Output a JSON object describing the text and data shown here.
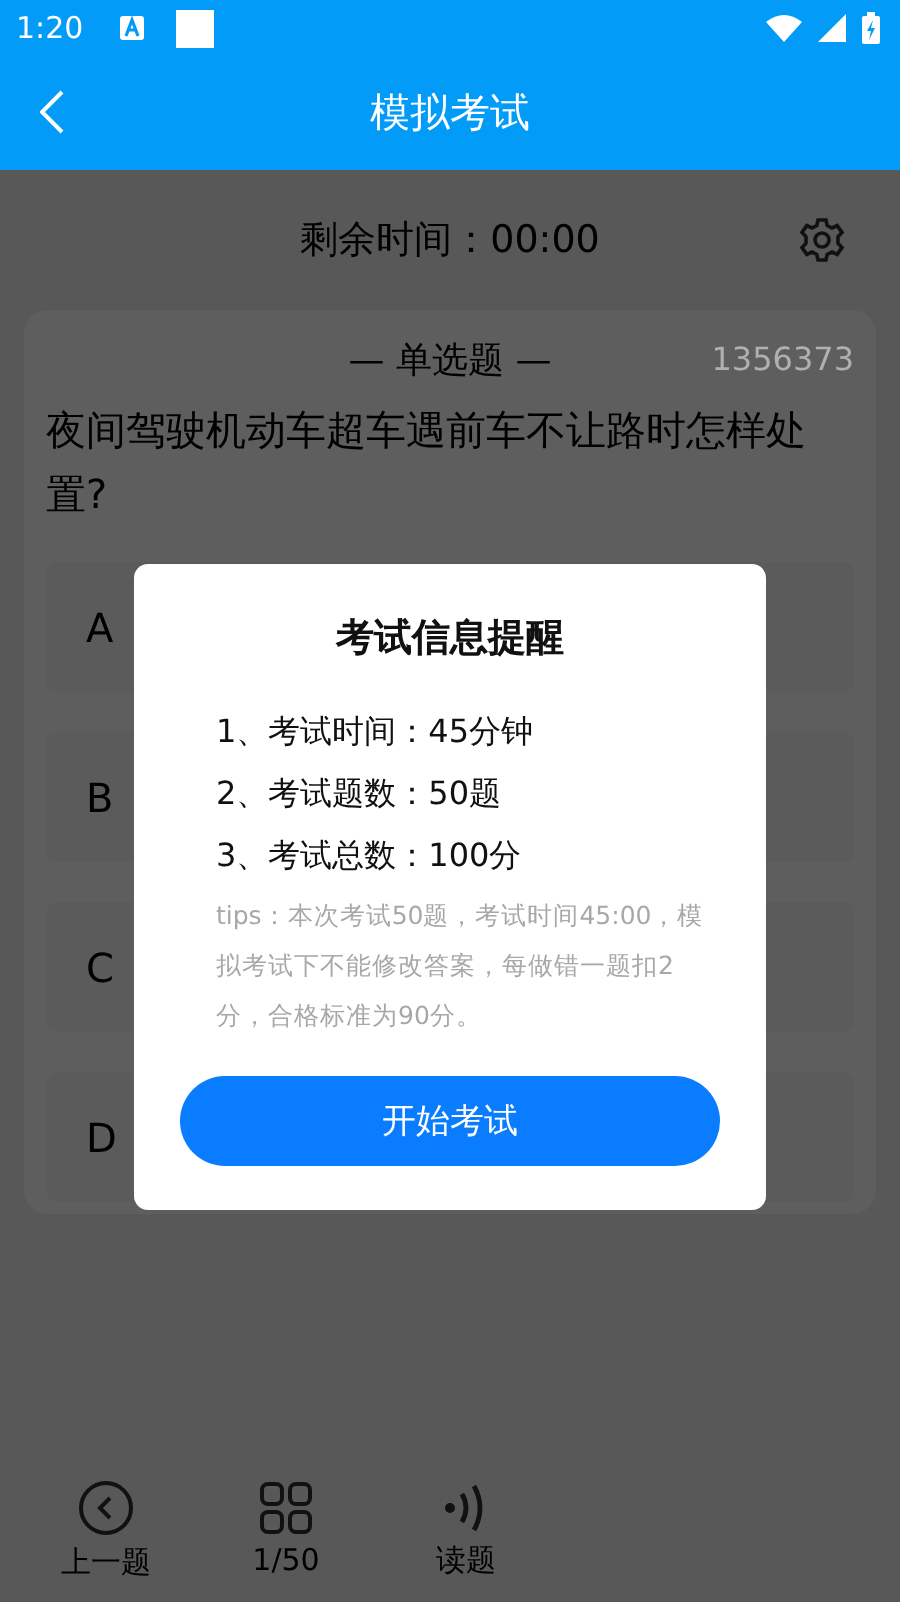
{
  "status_bar": {
    "time": "1:20"
  },
  "header": {
    "title": "模拟考试"
  },
  "timer": {
    "label": "剩余时间：00:00"
  },
  "question": {
    "type": "— 单选题 —",
    "id": "1356373",
    "text": "夜间驾驶机动车超车遇前车不让路时怎样处置?",
    "options": [
      {
        "label": "A"
      },
      {
        "label": "B"
      },
      {
        "label": "C"
      },
      {
        "label": "D"
      }
    ]
  },
  "bottom_bar": [
    {
      "kind": "prev",
      "label": "上一题"
    },
    {
      "kind": "grid",
      "label": "1/50"
    },
    {
      "kind": "read",
      "label": "读题"
    }
  ],
  "dialog": {
    "title": "考试信息提醒",
    "items": [
      "1、考试时间：45分钟",
      "2、考试题数：50题",
      "3、考试总数：100分"
    ],
    "tips": "tips：本次考试50题，考试时间45:00，模拟考试下不能修改答案，每做错一题扣2分，合格标准为90分。",
    "button": "开始考试"
  }
}
